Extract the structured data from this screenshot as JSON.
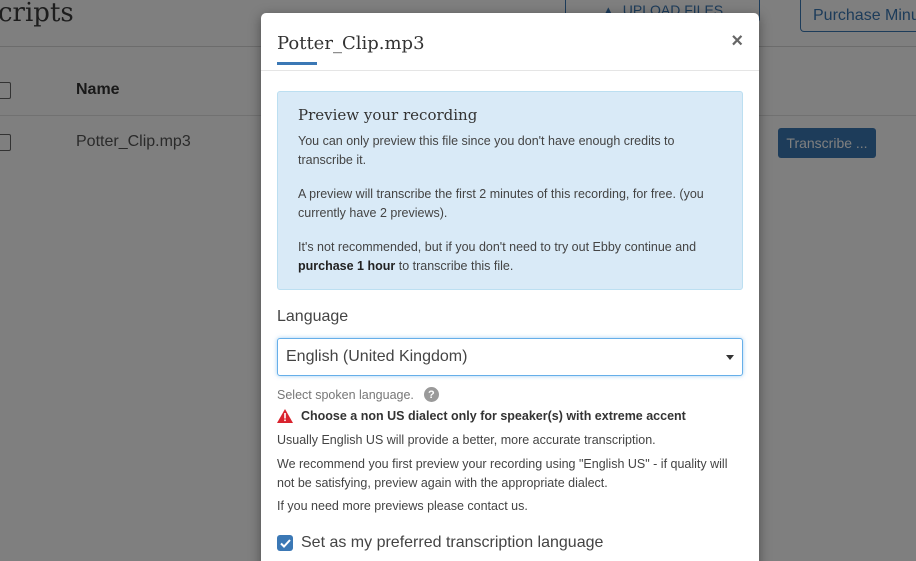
{
  "background": {
    "page_title": "cripts",
    "upload_label": "UPLOAD FILES",
    "purchase_label": "Purchase Minu",
    "column_name": "Name",
    "file_name": "Potter_Clip.mp3",
    "transcribe_label": "Transcribe ..."
  },
  "modal": {
    "title": "Potter_Clip.mp3",
    "close_symbol": "×",
    "info": {
      "heading": "Preview your recording",
      "p1": "You can only preview this file since you don't have enough credits to transcribe it.",
      "p2": "A preview will transcribe the first 2 minutes of this recording, for free. (you currently have 2 previews).",
      "p3_prefix": "It's not recommended, but if you don't need to try out Ebby continue and ",
      "p3_bold": "purchase 1 hour",
      "p3_suffix": " to transcribe this file."
    },
    "language_label": "Language",
    "language_selected": "English (United Kingdom)",
    "help_text": "Select spoken language.",
    "warning_text": "Choose a non US dialect only for speaker(s) with extreme accent",
    "note1": "Usually English US will provide a better, more accurate transcription.",
    "note2": "We recommend you first preview your recording using \"English US\" - if quality will not be satisfying, preview again with the appropriate dialect.",
    "note3": "If you need more previews please contact us.",
    "preferred_label": "Set as my preferred transcription language",
    "preferred_checked": true
  },
  "colors": {
    "accent": "#3b78b5",
    "info_bg": "#d9eaf7",
    "warning": "#d9232e"
  }
}
